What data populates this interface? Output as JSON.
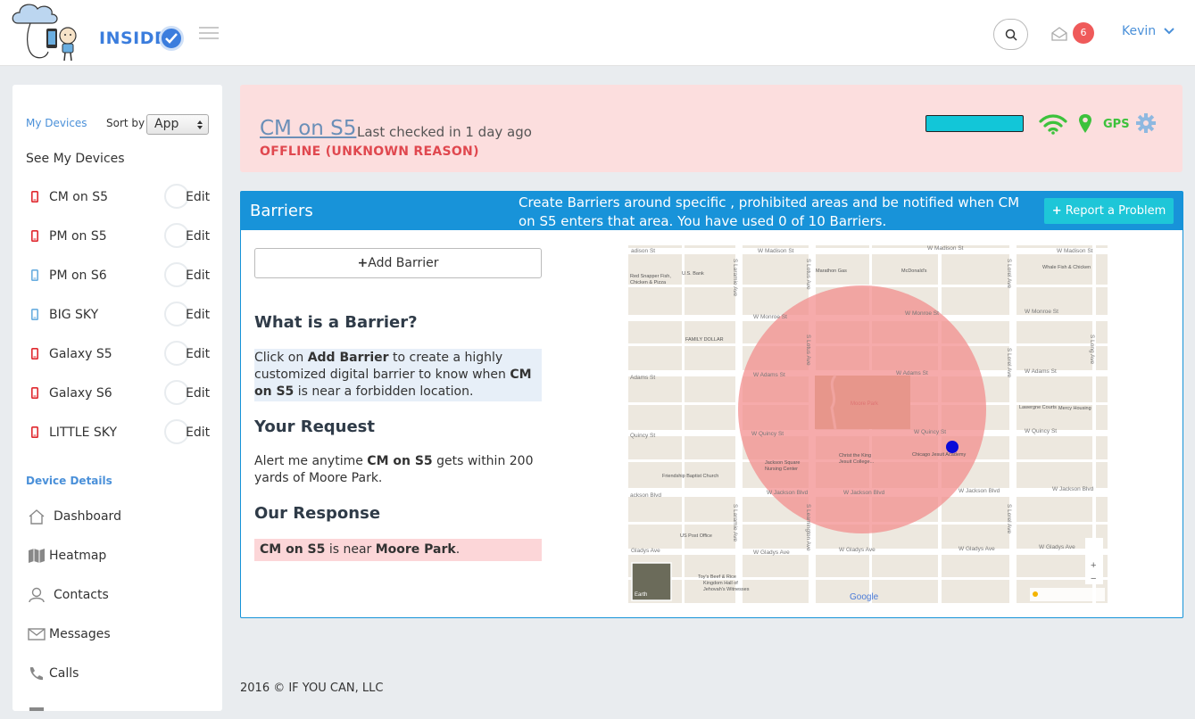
{
  "header": {
    "brand": "INSIDER",
    "notification_count": "6",
    "user_name": "Kevin"
  },
  "sidebar": {
    "my_devices_label": "My Devices",
    "sort_by_label": "Sort by",
    "sort_value": "App",
    "see_devices_label": "See My Devices",
    "devices": [
      {
        "name": "CM on S5",
        "edit": "Edit",
        "phone_color": "#e0292f"
      },
      {
        "name": "PM on S5",
        "edit": "Edit",
        "phone_color": "#e0292f"
      },
      {
        "name": "PM on S6",
        "edit": "Edit",
        "phone_color": "#6aaee0"
      },
      {
        "name": "BIG SKY",
        "edit": "Edit",
        "phone_color": "#6aaee0"
      },
      {
        "name": "Galaxy S5",
        "edit": "Edit",
        "phone_color": "#e0292f"
      },
      {
        "name": "Galaxy S6",
        "edit": "Edit",
        "phone_color": "#e0292f"
      },
      {
        "name": "LITTLE SKY",
        "edit": "Edit",
        "phone_color": "#e0292f"
      }
    ],
    "device_details_label": "Device Details",
    "nav": [
      {
        "label": "Dashboard",
        "icon": "home-icon"
      },
      {
        "label": "Heatmap",
        "icon": "map-icon"
      },
      {
        "label": "Contacts",
        "icon": "user-icon"
      },
      {
        "label": "Messages",
        "icon": "envelope-icon"
      },
      {
        "label": "Calls",
        "icon": "phone-icon"
      }
    ]
  },
  "status": {
    "device_name": "CM on S5",
    "last_checked": "Last checked in 1 day ago",
    "offline_text": "OFFLINE (UNKNOWN REASON)",
    "gps_label": "GPS",
    "colors": {
      "bar": "#12c6d8",
      "wifi": "#3cc23c",
      "offline": "#e0484f"
    }
  },
  "barriers": {
    "title": "Barriers",
    "description": "Create Barriers around specific , prohibited areas and be notified when CM on S5 enters that area. You have used 0 of 10 Barriers.",
    "report_button": "Report a Problem",
    "add_button": "Add Barrier",
    "what_heading": "What is a Barrier?",
    "what_parts": {
      "p1": "Click on ",
      "b1": "Add Barrier",
      "p2": " to create a highly customized digital barrier to know when ",
      "b2": "CM on S5",
      "p3": " is near a forbidden location."
    },
    "request_heading": "Your Request",
    "request_parts": {
      "p1": "Alert me anytime ",
      "b1": "CM on S5",
      "p2": " gets within 200 yards of Moore Park."
    },
    "response_heading": "Our Response",
    "response_parts": {
      "b1": "CM on S5",
      "p1": " is near ",
      "b2": "Moore Park",
      "p2": "."
    }
  },
  "map": {
    "streets_h": [
      "W Madison St",
      "W Monroe St",
      "W Adams St",
      "W Quincy St",
      "W Jackson Blvd",
      "W Gladys Ave"
    ],
    "streets_v": [
      "S Laramie Ave",
      "S Lotus Ave",
      "S Lockwood Ave",
      "S Leamington Ave",
      "S Lorel Ave"
    ],
    "places": [
      "Moore Park",
      "Marathon Gas",
      "McDonald's",
      "Whale Fish & Chicken",
      "Red Snapper Fish, Chicken & Pizza",
      "U.S. Bank",
      "FAMILY DOLLAR",
      "Lawergne Courts",
      "Mercy Housing",
      "Jackson Square Nursing Center",
      "Christ the King Jesuit College...",
      "Chicago Jesuit Academy",
      "Friendship Baptist Church",
      "US Post Office",
      "Toy's Beef & Rice",
      "Kingdom Hall of Jehovah's Witnesses"
    ],
    "earth_label": "Earth",
    "google_label": "Google",
    "zoom_in": "+",
    "zoom_out": "−"
  },
  "footer": {
    "text": "2016 © IF YOU CAN, LLC"
  }
}
